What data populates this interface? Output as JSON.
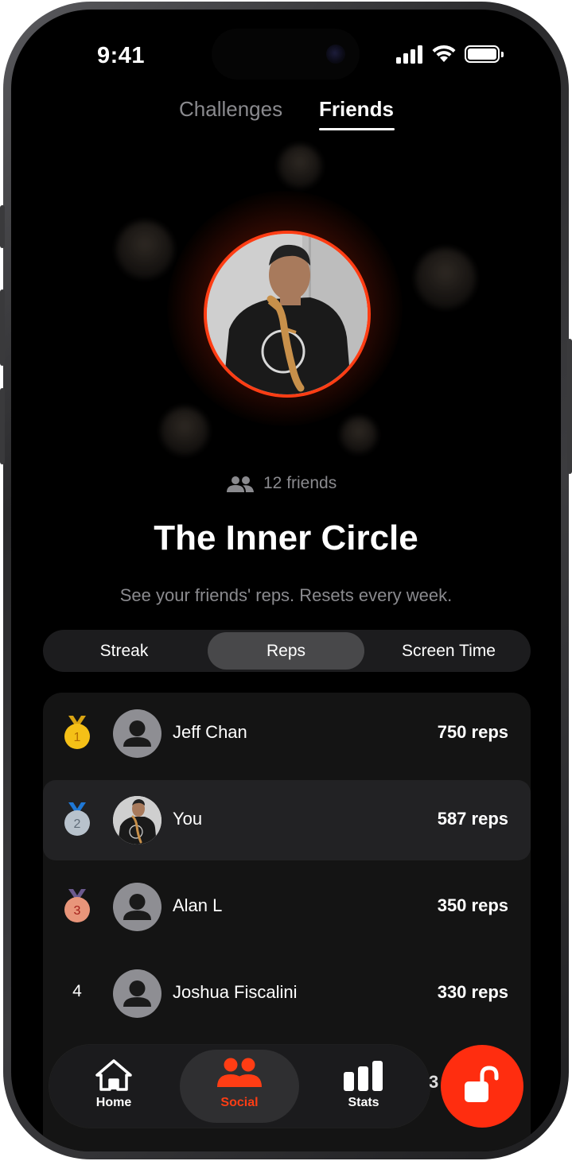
{
  "status_bar": {
    "time": "9:41"
  },
  "top_tabs": [
    {
      "label": "Challenges",
      "active": false
    },
    {
      "label": "Friends",
      "active": true
    }
  ],
  "circle": {
    "friends_count": "12 friends",
    "title": "The Inner Circle",
    "subtitle": "See your friends' reps. Resets every week."
  },
  "segments": [
    {
      "label": "Streak",
      "active": false
    },
    {
      "label": "Reps",
      "active": true
    },
    {
      "label": "Screen Time",
      "active": false
    }
  ],
  "leaderboard": [
    {
      "rank": "1",
      "name": "Jeff Chan",
      "score": "750 reps",
      "medal": "gold"
    },
    {
      "rank": "2",
      "name": "You",
      "score": "587 reps",
      "medal": "silver"
    },
    {
      "rank": "3",
      "name": "Alan L",
      "score": "350 reps",
      "medal": "bronze"
    },
    {
      "rank": "4",
      "name": "Joshua Fiscalini",
      "score": "330 reps",
      "medal": ""
    }
  ],
  "partial_row": {
    "score_fragment": "3"
  },
  "bottom_nav": [
    {
      "label": "Home",
      "icon": "home-icon",
      "active": false
    },
    {
      "label": "Social",
      "icon": "people-icon",
      "active": true
    },
    {
      "label": "Stats",
      "icon": "bar-chart-icon",
      "active": false
    }
  ],
  "fab": {
    "icon": "unlock-icon"
  },
  "colors": {
    "accent": "#ff2d0f",
    "background": "#000000",
    "card": "#141414",
    "muted_text": "#8a8a8e",
    "gold": "#f5c017",
    "silver": "#b8c2cc",
    "bronze": "#e8957a"
  }
}
